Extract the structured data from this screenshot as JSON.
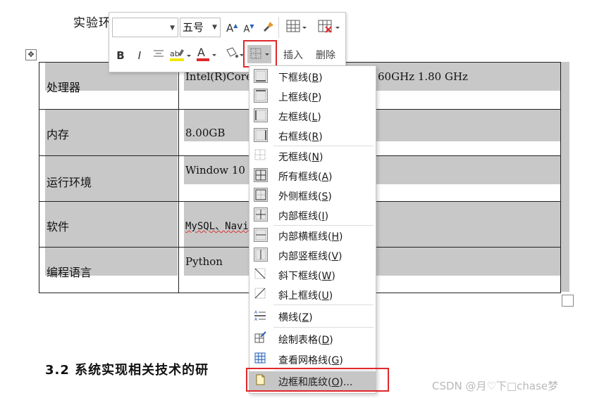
{
  "document": {
    "title_fragment": "实验环",
    "table_rows": [
      {
        "label": "处理器",
        "value": "Intel(R)Core("
      },
      {
        "label": "内存",
        "value": "8.00GB"
      },
      {
        "label": "运行环境",
        "value": "Window 10"
      },
      {
        "label": "软件",
        "value": "MySQL、Navi"
      },
      {
        "label": "编程语言",
        "value": "Python"
      }
    ],
    "row1_value_tail": "60GHz 1.80 GHz",
    "section_heading": "3.2  系统实现相关技术的研",
    "watermark": "CSDN @月♡下□chase梦"
  },
  "mini_toolbar": {
    "font_name_value": "",
    "font_size_value": "五号",
    "grow_font": "A",
    "shrink_font": "A",
    "bold": "B",
    "italic": "I",
    "insert_label": "插入",
    "delete_label": "删除",
    "accent_color": "#e0282b",
    "highlight_color": "#f2e600",
    "font_color": "#e0282b"
  },
  "borders_menu": {
    "items": [
      {
        "icon": "bottom-border-icon",
        "label": "下框线",
        "key": "B"
      },
      {
        "icon": "top-border-icon",
        "label": "上框线",
        "key": "P"
      },
      {
        "icon": "left-border-icon",
        "label": "左框线",
        "key": "L"
      },
      {
        "icon": "right-border-icon",
        "label": "右框线",
        "key": "R"
      },
      {
        "icon": "no-border-icon",
        "label": "无框线",
        "key": "N"
      },
      {
        "icon": "all-borders-icon",
        "label": "所有框线",
        "key": "A"
      },
      {
        "icon": "outside-borders-icon",
        "label": "外侧框线",
        "key": "S"
      },
      {
        "icon": "inside-borders-icon",
        "label": "内部框线",
        "key": "I"
      },
      {
        "icon": "inside-horizontal-border-icon",
        "label": "内部横框线",
        "key": "H"
      },
      {
        "icon": "inside-vertical-border-icon",
        "label": "内部竖框线",
        "key": "V"
      },
      {
        "icon": "diagonal-down-border-icon",
        "label": "斜下框线",
        "key": "W"
      },
      {
        "icon": "diagonal-up-border-icon",
        "label": "斜上框线",
        "key": "U"
      },
      {
        "icon": "horizontal-line-icon",
        "label": "横线",
        "key": "Z"
      },
      {
        "icon": "draw-table-icon",
        "label": "绘制表格",
        "key": "D"
      },
      {
        "icon": "view-gridlines-icon",
        "label": "查看网格线",
        "key": "G"
      },
      {
        "icon": "borders-shading-icon",
        "label": "边框和底纹",
        "key": "O",
        "suffix": "..."
      }
    ]
  }
}
